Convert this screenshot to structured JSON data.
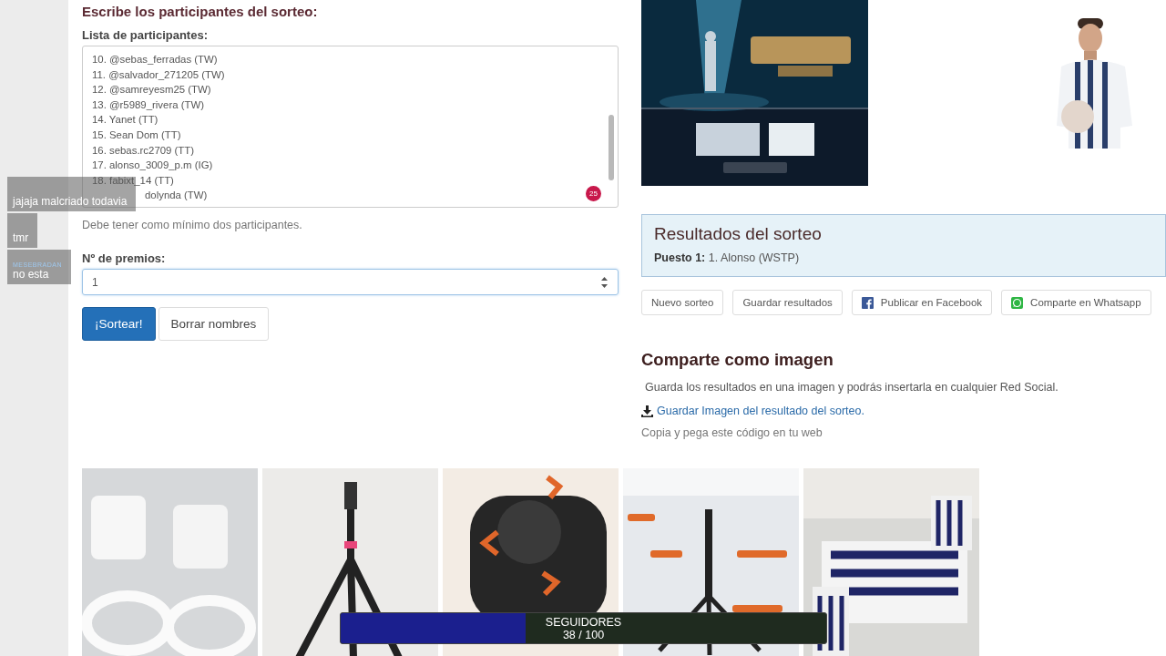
{
  "form": {
    "title": "Escribe los participantes del sorteo:",
    "list_label": "Lista de participantes:",
    "participants": [
      {
        "text": "10. @sebas_ferradas (TW)",
        "kind": "whole"
      },
      {
        "text": "11. @salvador_271205 (TW)",
        "kind": "whole"
      },
      {
        "text": "12. @samreyesm25 (TW)",
        "kind": "whole"
      },
      {
        "text": "13. @r5989_rivera (TW)",
        "kind": "whole"
      },
      {
        "text": "14. Yanet (TT)",
        "kind": "whole"
      },
      {
        "text": "15. Sean Dom (TT)",
        "kind": "whole"
      },
      {
        "text": "16. sebas.rc2709 (TT)",
        "kind": "whole"
      },
      {
        "text": "17. alonso_3009_p.m (IG)",
        "kind": "whole"
      },
      {
        "text": "18. fabixt_14 (TT)",
        "kind": "whole"
      },
      {
        "text": "dolynda (TW)",
        "kind": "covered"
      }
    ],
    "badge": "25",
    "help": "Debe tener como mínimo dos participantes.",
    "prizes_label": "Nº de premios:",
    "prizes_value": "1",
    "buttons": [
      {
        "label": "¡Sortear!",
        "kind": "primary"
      },
      {
        "label": "Borrar nombres",
        "kind": "default"
      }
    ]
  },
  "results": {
    "title": "Resultados del sorteo",
    "entries": [
      {
        "place": "Puesto 1:",
        "winner": "1. Alonso (WSTP)"
      }
    ]
  },
  "actions": [
    {
      "label": "Nuevo sorteo",
      "kind": "plain"
    },
    {
      "label": "Guardar resultados",
      "kind": "plain"
    },
    {
      "label": "Publicar en Facebook",
      "kind": "facebook"
    },
    {
      "label": "Comparte en Whatsapp",
      "kind": "whatsapp"
    }
  ],
  "share": {
    "title": "Comparte como imagen",
    "text": "Guarda los resultados en una imagen y podrás insertarla en cualquier Red Social.",
    "link": "Guardar Imagen del resultado del sorteo.",
    "code_label": "Copia y pega este código en tu web"
  },
  "products": [
    {
      "kind": "charger"
    },
    {
      "kind": "tripod"
    },
    {
      "kind": "closeup"
    },
    {
      "kind": "stand"
    },
    {
      "kind": "table"
    }
  ],
  "chat": [
    {
      "message": "jajaja malcriado todavia"
    },
    {
      "message": "tmr"
    },
    {
      "user": "MESEBRADAN",
      "message": "no esta"
    }
  ],
  "followers": {
    "label": "SEGUIDORES",
    "reading": "38 / 100",
    "level": 0.38
  }
}
